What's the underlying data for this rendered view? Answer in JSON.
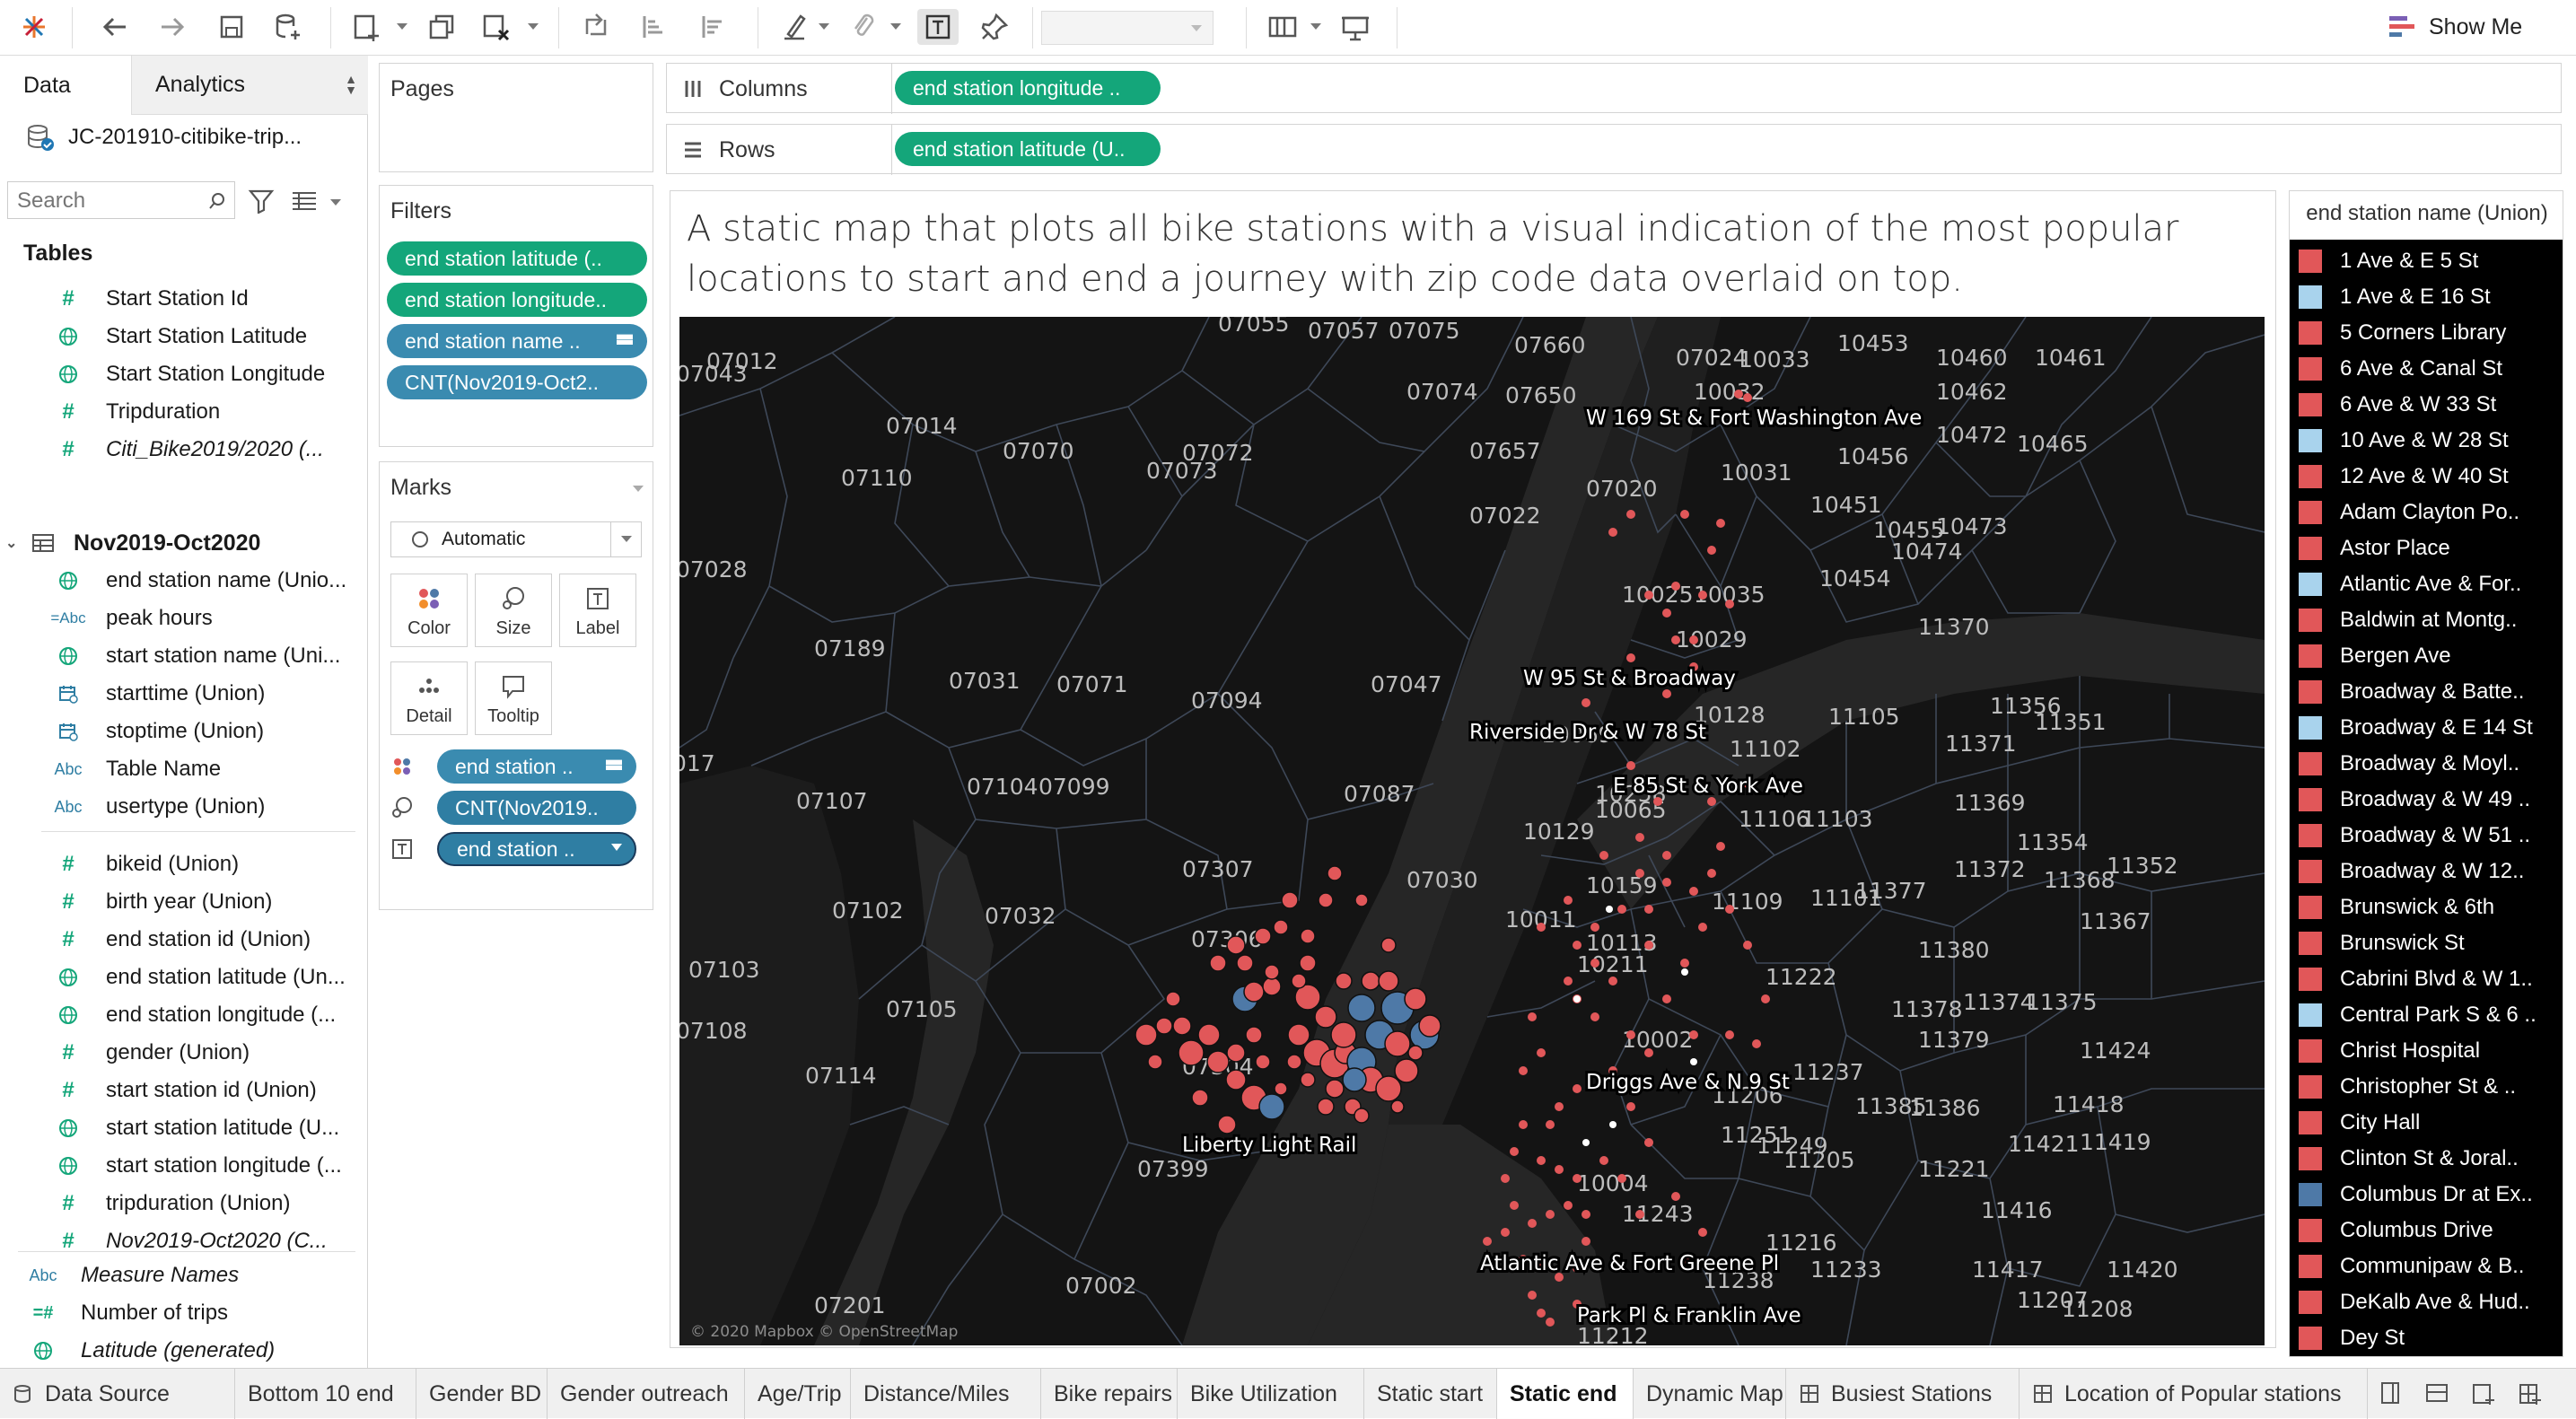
{
  "toolbar": {
    "show_me_label": "Show Me",
    "icons": [
      "tableau-logo-icon",
      "undo-icon",
      "redo-icon",
      "save-icon",
      "new-datasource-icon",
      "new-worksheet-icon",
      "duplicate-icon",
      "clear-sheet-icon",
      "swap-icon",
      "sort-ascending-icon",
      "sort-descending-icon",
      "highlight-icon",
      "group-icon",
      "show-labels-icon",
      "pin-icon",
      "fit-dropdown",
      "show-cards-icon",
      "presentation-icon"
    ]
  },
  "data_pane": {
    "tab_data": "Data",
    "tab_analytics": "Analytics",
    "datasource": "JC-201910-citibike-trip...",
    "search_placeholder": "Search",
    "tables_header": "Tables",
    "fields_1": [
      {
        "icon": "#",
        "label": "Start Station Id",
        "italic": false
      },
      {
        "icon": "globe",
        "label": "Start Station Latitude",
        "italic": false
      },
      {
        "icon": "globe",
        "label": "Start Station Longitude",
        "italic": false
      },
      {
        "icon": "#",
        "label": "Tripduration",
        "italic": false
      },
      {
        "icon": "#",
        "label": "Citi_Bike2019/2020 (...",
        "italic": true
      }
    ],
    "table_2": "Nov2019-Oct2020",
    "fields_2": [
      {
        "icon": "globe",
        "label": "end station name (Unio...",
        "italic": false
      },
      {
        "icon": "=Abc",
        "label": "peak hours",
        "italic": false
      },
      {
        "icon": "globe",
        "label": "start station name (Uni...",
        "italic": false
      },
      {
        "icon": "cal",
        "label": "starttime (Union)",
        "italic": false
      },
      {
        "icon": "cal",
        "label": "stoptime (Union)",
        "italic": false
      },
      {
        "icon": "Abc",
        "label": "Table Name",
        "italic": false
      },
      {
        "icon": "Abc",
        "label": "usertype (Union)",
        "italic": false
      },
      {
        "icon": "#",
        "label": "bikeid (Union)",
        "italic": false
      },
      {
        "icon": "#",
        "label": "birth year (Union)",
        "italic": false
      },
      {
        "icon": "#",
        "label": "end station id (Union)",
        "italic": false
      },
      {
        "icon": "globe",
        "label": "end station latitude (Un...",
        "italic": false
      },
      {
        "icon": "globe",
        "label": "end station longitude (...",
        "italic": false
      },
      {
        "icon": "#",
        "label": "gender (Union)",
        "italic": false
      },
      {
        "icon": "#",
        "label": "start station id (Union)",
        "italic": false
      },
      {
        "icon": "globe",
        "label": "start station latitude (U...",
        "italic": false
      },
      {
        "icon": "globe",
        "label": "start station longitude (...",
        "italic": false
      },
      {
        "icon": "#",
        "label": "tripduration (Union)",
        "italic": false
      },
      {
        "icon": "#",
        "label": "Nov2019-Oct2020 (C...",
        "italic": true
      }
    ],
    "fields_3": [
      {
        "icon": "Abc",
        "label": "Measure Names",
        "italic": true
      },
      {
        "icon": "=#",
        "label": "Number of trips",
        "italic": false
      },
      {
        "icon": "globe",
        "label": "Latitude (generated)",
        "italic": true
      },
      {
        "icon": "globe",
        "label": "Longitude (generated)",
        "italic": true
      }
    ]
  },
  "pages_title": "Pages",
  "filters": {
    "title": "Filters",
    "pills": [
      "end station latitude (..",
      "end station longitude..",
      "end station name ..",
      "CNT(Nov2019-Oct2.."
    ]
  },
  "marks": {
    "title": "Marks",
    "type": "Automatic",
    "buttons": [
      "Color",
      "Size",
      "Label",
      "Detail",
      "Tooltip"
    ],
    "pills": [
      "end station ..",
      "CNT(Nov2019..",
      "end station .."
    ]
  },
  "shelves": {
    "columns_label": "Columns",
    "columns_pill": "end station longitude ..",
    "rows_label": "Rows",
    "rows_pill": "end station latitude (U.."
  },
  "viz": {
    "title": "A static map that plots all bike stations with a visual indication of the most popular locations to start and end a journey with zip code data overlaid on top.",
    "attribution": "© 2020 Mapbox © OpenStreetMap",
    "station_labels": [
      "W 169 St & Fort Washington Ave",
      "W 95 St & Broadway",
      "Riverside Dr & W 78 St",
      "E 85 St & York Ave",
      "Driggs Ave & N 9 St",
      "Liberty Light Rail",
      "Atlantic Ave & Fort Greene Pl",
      "Park Pl & Franklin Ave"
    ],
    "zip_labels": [
      "07055",
      "07057",
      "07075",
      "07012",
      "07043",
      "07660",
      "07024",
      "10033",
      "10453",
      "10460",
      "10461",
      "10462",
      "07074",
      "07650",
      "10032",
      "07014",
      "07657",
      "07070",
      "07072",
      "07110",
      "07073",
      "07022",
      "07020",
      "10031",
      "10456",
      "10472",
      "10465",
      "10451",
      "10455",
      "10473",
      "07028",
      "10474",
      "10454",
      "10025",
      "10035",
      "07189",
      "07071",
      "07047",
      "10029",
      "11370",
      "07031",
      "07094",
      "10128",
      "11105",
      "11356",
      "11351",
      "10069",
      "11371",
      "07087",
      "10065",
      "11102",
      "07104",
      "07099",
      "07107",
      "11106",
      "11103",
      "11369",
      "11354",
      "10129",
      "07030",
      "07307",
      "11109",
      "11101",
      "11377",
      "11372",
      "11368",
      "11352",
      "10159",
      "07032",
      "07102",
      "10011",
      "07306",
      "11380",
      "11367",
      "07103",
      "10211",
      "11222",
      "11378",
      "11374",
      "11375",
      "07105",
      "07108",
      "11379",
      "10002",
      "11424",
      "07304",
      "11237",
      "07114",
      "11206",
      "11418",
      "11385",
      "11386",
      "11251",
      "11249",
      "11205",
      "11421",
      "11419",
      "07399",
      "11221",
      "10004",
      "11243",
      "11416",
      "11216",
      "11233",
      "11417",
      "11420",
      "07201",
      "07002",
      "11238",
      "11212",
      "11208",
      "11207",
      "017",
      "10258",
      "10113"
    ],
    "colors": {
      "red": "#e15759",
      "blue": "#4e79a7",
      "background": "#141414"
    }
  },
  "legend": {
    "title": "end station name (Union)",
    "items": [
      {
        "label": "1 Ave & E 5 St",
        "color": "#e15759"
      },
      {
        "label": "1 Ave & E 16 St",
        "color": "#a9d3ed"
      },
      {
        "label": "5 Corners Library",
        "color": "#e15759"
      },
      {
        "label": "6 Ave & Canal St",
        "color": "#e15759"
      },
      {
        "label": "6 Ave & W 33 St",
        "color": "#e15759"
      },
      {
        "label": "10 Ave & W 28 St",
        "color": "#a9d3ed"
      },
      {
        "label": "12 Ave & W 40 St",
        "color": "#e15759"
      },
      {
        "label": "Adam Clayton Po..",
        "color": "#e15759"
      },
      {
        "label": "Astor Place",
        "color": "#e15759"
      },
      {
        "label": "Atlantic Ave & For..",
        "color": "#a9d3ed"
      },
      {
        "label": "Baldwin at Montg..",
        "color": "#e15759"
      },
      {
        "label": "Bergen Ave",
        "color": "#e15759"
      },
      {
        "label": "Broadway & Batte..",
        "color": "#e15759"
      },
      {
        "label": "Broadway & E 14 St",
        "color": "#a9d3ed"
      },
      {
        "label": "Broadway & Moyl..",
        "color": "#e15759"
      },
      {
        "label": "Broadway & W 49 ..",
        "color": "#e15759"
      },
      {
        "label": "Broadway & W 51 ..",
        "color": "#e15759"
      },
      {
        "label": "Broadway & W 12..",
        "color": "#e15759"
      },
      {
        "label": "Brunswick & 6th",
        "color": "#e15759"
      },
      {
        "label": "Brunswick St",
        "color": "#e15759"
      },
      {
        "label": "Cabrini Blvd & W 1..",
        "color": "#e15759"
      },
      {
        "label": "Central Park S & 6 ..",
        "color": "#a9d3ed"
      },
      {
        "label": "Christ Hospital",
        "color": "#e15759"
      },
      {
        "label": "Christopher St & ..",
        "color": "#e15759"
      },
      {
        "label": "City Hall",
        "color": "#e15759"
      },
      {
        "label": "Clinton St & Joral..",
        "color": "#e15759"
      },
      {
        "label": "Columbus Dr at Ex..",
        "color": "#4e79a7"
      },
      {
        "label": "Columbus Drive",
        "color": "#e15759"
      },
      {
        "label": "Communipaw & B..",
        "color": "#e15759"
      },
      {
        "label": "DeKalb Ave & Hud..",
        "color": "#e15759"
      },
      {
        "label": "Dey St",
        "color": "#e15759"
      }
    ]
  },
  "bottom_tabs": [
    {
      "label": "Data Source",
      "active": false
    },
    {
      "label": "Bottom 10 end",
      "active": false
    },
    {
      "label": "Gender BD",
      "active": false
    },
    {
      "label": "Gender outreach",
      "active": false
    },
    {
      "label": "Age/Trip",
      "active": false
    },
    {
      "label": "Distance/Miles",
      "active": false
    },
    {
      "label": "Bike repairs",
      "active": false
    },
    {
      "label": "Bike Utilization",
      "active": false
    },
    {
      "label": "Static start",
      "active": false
    },
    {
      "label": "Static end",
      "active": true
    },
    {
      "label": "Dynamic Map",
      "active": false
    },
    {
      "label": "Busiest Stations",
      "active": false
    },
    {
      "label": "Location of Popular stations",
      "active": false
    }
  ]
}
